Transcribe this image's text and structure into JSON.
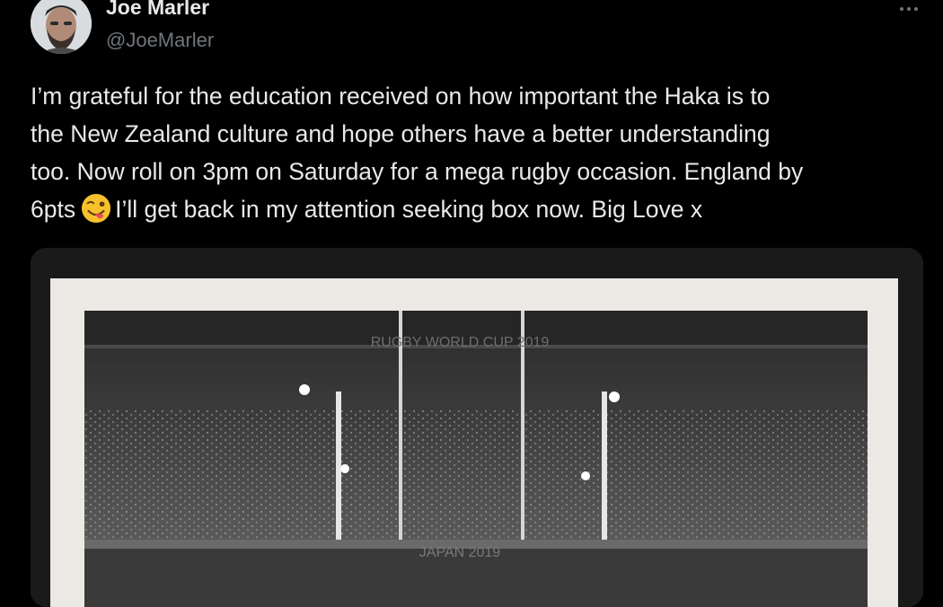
{
  "author": {
    "name": "Joe Marler",
    "handle": "@JoeMarler"
  },
  "tweet": {
    "lines": [
      "I’m grateful for the education received on how important the Haka is to",
      "the New Zealand culture and hope others have a better understanding",
      "too. Now roll on 3pm on Saturday for a mega rugby occasion. England by"
    ],
    "last_line_before_emoji": "6pts",
    "emoji": "winking-face-with-tongue",
    "last_line_after_emoji": "I’ll get back in my attention seeking box now. Big Love x"
  },
  "media": {
    "banner_top": "RUGBY WORLD CUP 2019",
    "banner_bottom": "JAPAN 2019"
  },
  "icons": {
    "more": "more-horizontal-icon"
  },
  "colors": {
    "background": "#000000",
    "text": "#e7e9ea",
    "secondary": "#71767b"
  }
}
